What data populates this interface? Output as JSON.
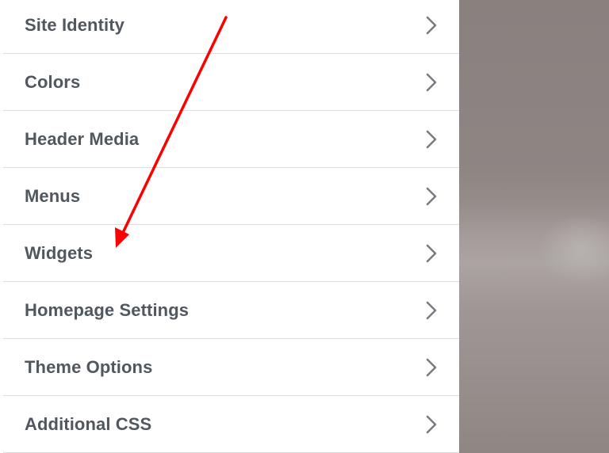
{
  "customizer": {
    "items": [
      {
        "label": "Site Identity"
      },
      {
        "label": "Colors"
      },
      {
        "label": "Header Media"
      },
      {
        "label": "Menus"
      },
      {
        "label": "Widgets"
      },
      {
        "label": "Homepage Settings"
      },
      {
        "label": "Theme Options"
      },
      {
        "label": "Additional CSS"
      }
    ],
    "label_color": "#50575e",
    "divider_color": "#dcdcde",
    "chevron_color": "#787c82"
  },
  "annotation": {
    "arrow_color": "#ff0000",
    "points_to": "Widgets"
  },
  "icons": {
    "item_chevron": "chevron-right-icon"
  }
}
